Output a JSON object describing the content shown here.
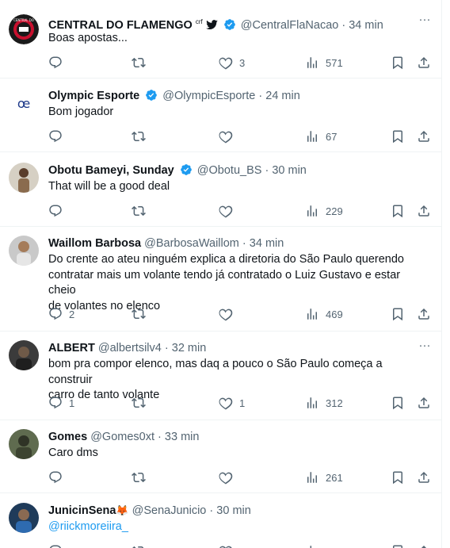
{
  "tweets": [
    {
      "name": "CENTRAL DO FLAMENGO",
      "name_suffix": "crf",
      "handle": "@CentralFlaNacao",
      "time": "34 min",
      "text": "Boas apostas...",
      "replies": "",
      "retweets": "",
      "likes": "3",
      "views": "571"
    },
    {
      "name": "Olympic Esporte",
      "handle": "@OlympicEsporte",
      "time": "24 min",
      "text": "Bom jogador",
      "replies": "",
      "retweets": "",
      "likes": "",
      "views": "67"
    },
    {
      "name": "Obotu Bameyi, Sunday",
      "handle": "@Obotu_BS",
      "time": "30 min",
      "text": "That will be a good deal",
      "replies": "",
      "retweets": "",
      "likes": "",
      "views": "229"
    },
    {
      "name": "Waillom Barbosa",
      "handle": "@BarbosaWaillom",
      "time": "34 min",
      "text_lines": [
        "Do crente ao ateu ninguém explica a diretoria do São Paulo querendo",
        "contratar mais um volante tendo já contratado o Luiz Gustavo e estar cheio",
        "de volantes no elenco"
      ],
      "replies": "2",
      "retweets": "",
      "likes": "",
      "views": "469"
    },
    {
      "name": "ALBERT",
      "handle": "@albertsilv4",
      "time": "32 min",
      "text_lines": [
        "bom pra compor elenco, mas daq a pouco o São Paulo começa a construir",
        "carro de tanto volante"
      ],
      "replies": "1",
      "retweets": "",
      "likes": "1",
      "views": "312"
    },
    {
      "name": "Gomes",
      "handle": "@Gomes0xt",
      "time": "33 min",
      "text": "Caro dms",
      "replies": "",
      "retweets": "",
      "likes": "",
      "views": "261"
    },
    {
      "name": "JunicinSena",
      "name_emoji": "🦊",
      "handle": "@SenaJunicio",
      "time": "30 min",
      "text": "@riickmoreiira_",
      "replies": "",
      "retweets": "",
      "likes": "",
      "views": ""
    }
  ],
  "icons": {
    "reply": "reply-icon",
    "retweet": "retweet-icon",
    "like": "heart-icon",
    "views": "views-icon",
    "bookmark": "bookmark-icon",
    "share": "share-icon",
    "more": "more-icon",
    "verified": "verified-badge-icon"
  },
  "colors": {
    "verified": "#1d9bf0",
    "link": "#1d9bf0",
    "secondary_text": "#536471"
  }
}
